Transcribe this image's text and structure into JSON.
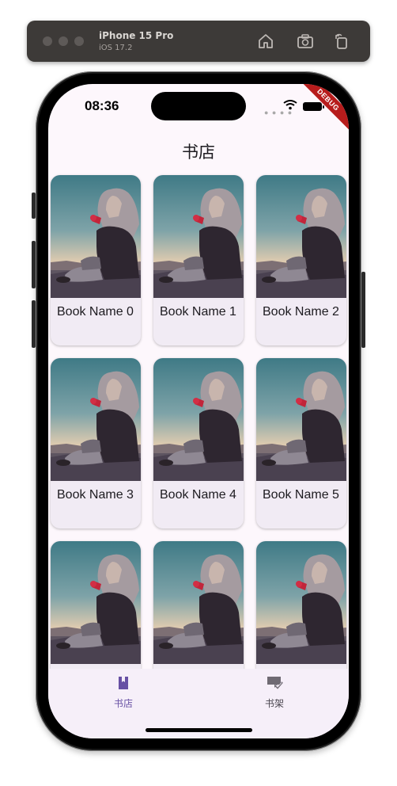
{
  "simulator": {
    "device_name": "iPhone 15 Pro",
    "os_version": "iOS 17.2",
    "icons": [
      "home-icon",
      "screenshot-icon",
      "rotate-icon"
    ]
  },
  "status_bar": {
    "time": "08:36",
    "icons": [
      "signal-icon",
      "wifi-icon",
      "battery-icon"
    ]
  },
  "debug_banner": "DEBUG",
  "app_bar": {
    "title": "书店"
  },
  "books": [
    {
      "title": "Book Name 0"
    },
    {
      "title": "Book Name 1"
    },
    {
      "title": "Book Name 2"
    },
    {
      "title": "Book Name 3"
    },
    {
      "title": "Book Name 4"
    },
    {
      "title": "Book Name 5"
    },
    {
      "title": ""
    },
    {
      "title": ""
    },
    {
      "title": ""
    }
  ],
  "bottom_nav": {
    "items": [
      {
        "label": "书店",
        "icon": "book-icon",
        "selected": true
      },
      {
        "label": "书架",
        "icon": "bookshelf-check-icon",
        "selected": false
      }
    ],
    "selected_color": "#6750a4",
    "unselected_color": "#49454f"
  }
}
